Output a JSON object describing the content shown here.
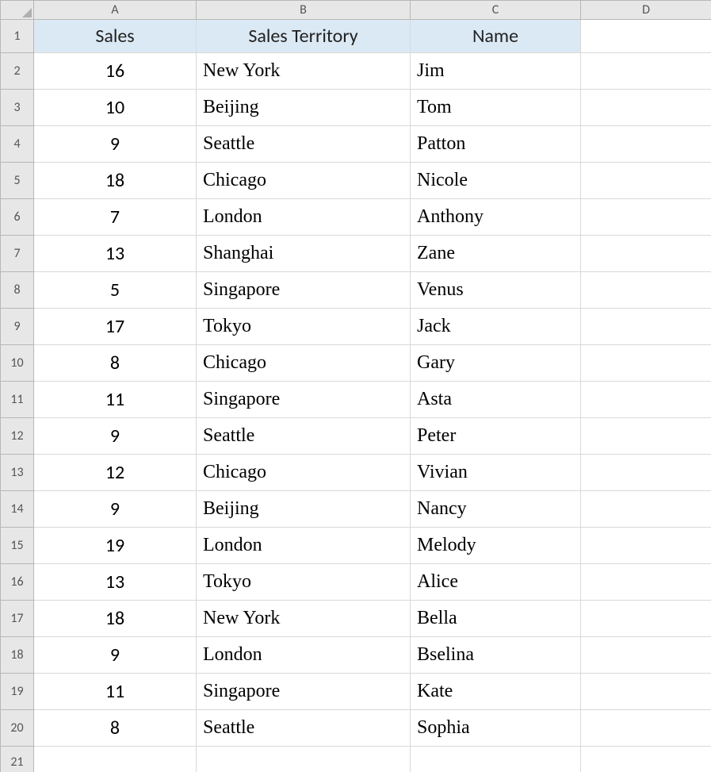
{
  "columns": [
    "A",
    "B",
    "C",
    "D"
  ],
  "row_numbers": [
    1,
    2,
    3,
    4,
    5,
    6,
    7,
    8,
    9,
    10,
    11,
    12,
    13,
    14,
    15,
    16,
    17,
    18,
    19,
    20,
    21
  ],
  "headers": {
    "a": "Sales",
    "b": "Sales Territory",
    "c": "Name"
  },
  "rows": [
    {
      "sales": "16",
      "territory": "New York",
      "name": "Jim"
    },
    {
      "sales": "10",
      "territory": "Beijing",
      "name": "Tom"
    },
    {
      "sales": "9",
      "territory": "Seattle",
      "name": "Patton"
    },
    {
      "sales": "18",
      "territory": "Chicago",
      "name": "Nicole"
    },
    {
      "sales": "7",
      "territory": "London",
      "name": "Anthony"
    },
    {
      "sales": "13",
      "territory": "Shanghai",
      "name": "Zane"
    },
    {
      "sales": "5",
      "territory": "Singapore",
      "name": "Venus"
    },
    {
      "sales": "17",
      "territory": "Tokyo",
      "name": "Jack"
    },
    {
      "sales": "8",
      "territory": "Chicago",
      "name": "Gary"
    },
    {
      "sales": "11",
      "territory": "Singapore",
      "name": "Asta"
    },
    {
      "sales": "9",
      "territory": "Seattle",
      "name": "Peter"
    },
    {
      "sales": "12",
      "territory": "Chicago",
      "name": "Vivian"
    },
    {
      "sales": "9",
      "territory": "Beijing",
      "name": "Nancy"
    },
    {
      "sales": "19",
      "territory": "London",
      "name": "Melody"
    },
    {
      "sales": "13",
      "territory": "Tokyo",
      "name": "Alice"
    },
    {
      "sales": "18",
      "territory": "New York",
      "name": "Bella"
    },
    {
      "sales": "9",
      "territory": "London",
      "name": "Bselina"
    },
    {
      "sales": "11",
      "territory": "Singapore",
      "name": "Kate"
    },
    {
      "sales": "8",
      "territory": "Seattle",
      "name": "Sophia"
    }
  ],
  "chart_data": {
    "type": "table",
    "title": "",
    "columns": [
      "Sales",
      "Sales Territory",
      "Name"
    ],
    "data": [
      [
        16,
        "New York",
        "Jim"
      ],
      [
        10,
        "Beijing",
        "Tom"
      ],
      [
        9,
        "Seattle",
        "Patton"
      ],
      [
        18,
        "Chicago",
        "Nicole"
      ],
      [
        7,
        "London",
        "Anthony"
      ],
      [
        13,
        "Shanghai",
        "Zane"
      ],
      [
        5,
        "Singapore",
        "Venus"
      ],
      [
        17,
        "Tokyo",
        "Jack"
      ],
      [
        8,
        "Chicago",
        "Gary"
      ],
      [
        11,
        "Singapore",
        "Asta"
      ],
      [
        9,
        "Seattle",
        "Peter"
      ],
      [
        12,
        "Chicago",
        "Vivian"
      ],
      [
        9,
        "Beijing",
        "Nancy"
      ],
      [
        19,
        "London",
        "Melody"
      ],
      [
        13,
        "Tokyo",
        "Alice"
      ],
      [
        18,
        "New York",
        "Bella"
      ],
      [
        9,
        "London",
        "Bselina"
      ],
      [
        11,
        "Singapore",
        "Kate"
      ],
      [
        8,
        "Seattle",
        "Sophia"
      ]
    ]
  }
}
